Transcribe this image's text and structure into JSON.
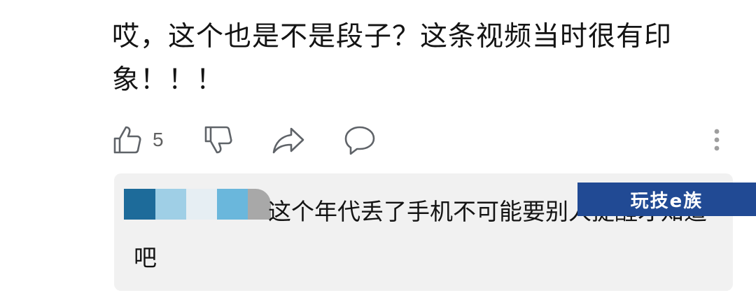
{
  "comment": {
    "text": "哎，这个也是不是段子？这条视频当时很有印象！！！"
  },
  "actions": {
    "like_count": "5",
    "icons": [
      "thumbs-up-icon",
      "thumbs-down-icon",
      "share-icon",
      "comment-icon",
      "more-vertical-icon"
    ]
  },
  "reply": {
    "text": "这个年代丢了手机不可能要别人提醒才知道吧"
  },
  "watermark": {
    "text": "玩技e族"
  },
  "colors": {
    "icon": "#5f6368",
    "reply_bg": "#f1f1f1",
    "watermark_bg": "#214a94",
    "redaction": [
      "#1d6b9a",
      "#9fcfe6",
      "#e6eef3",
      "#6ab7dc",
      "#a8a8a8"
    ]
  }
}
